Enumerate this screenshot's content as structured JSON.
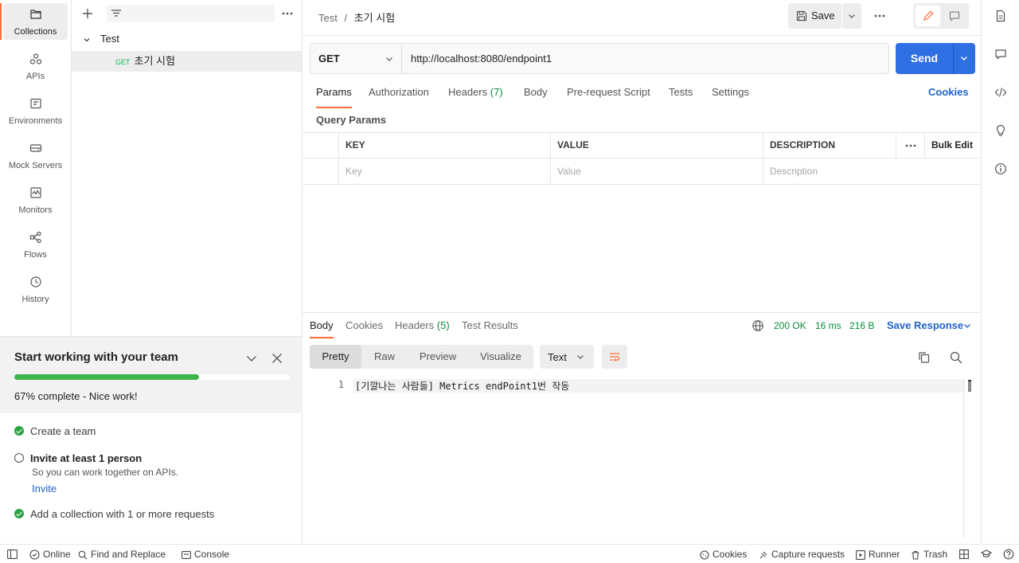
{
  "rail": {
    "items": [
      {
        "label": "Collections",
        "icon": "collections-icon"
      },
      {
        "label": "APIs",
        "icon": "apis-icon"
      },
      {
        "label": "Environments",
        "icon": "environments-icon"
      },
      {
        "label": "Mock Servers",
        "icon": "mock-servers-icon"
      },
      {
        "label": "Monitors",
        "icon": "monitors-icon"
      },
      {
        "label": "Flows",
        "icon": "flows-icon"
      },
      {
        "label": "History",
        "icon": "history-icon"
      }
    ]
  },
  "sidebar": {
    "collection_name": "Test",
    "request": {
      "method": "GET",
      "name": "초기 시험"
    }
  },
  "onboarding": {
    "title": "Start working with your team",
    "progress_percent": 67,
    "progress_text": "67% complete - Nice work!",
    "tasks": [
      {
        "label": "Create a team",
        "done": true
      },
      {
        "label": "Invite at least 1 person",
        "done": false,
        "description": "So you can work together on APIs.",
        "action": "Invite"
      },
      {
        "label": "Add a collection with 1 or more requests",
        "done": true
      }
    ]
  },
  "header": {
    "breadcrumb_parent": "Test",
    "breadcrumb_sep": "/",
    "breadcrumb_current": "초기 시험",
    "save_label": "Save"
  },
  "request": {
    "method": "GET",
    "url": "http://localhost:8080/endpoint1",
    "send_label": "Send",
    "tabs": [
      {
        "label": "Params",
        "active": true
      },
      {
        "label": "Authorization"
      },
      {
        "label": "Headers",
        "count": "(7)"
      },
      {
        "label": "Body"
      },
      {
        "label": "Pre-request Script"
      },
      {
        "label": "Tests"
      },
      {
        "label": "Settings"
      }
    ],
    "cookies_label": "Cookies",
    "query_params_title": "Query Params",
    "table": {
      "headers": {
        "key": "KEY",
        "value": "VALUE",
        "description": "DESCRIPTION",
        "bulk_edit": "Bulk Edit"
      },
      "placeholders": {
        "key": "Key",
        "value": "Value",
        "description": "Description"
      }
    }
  },
  "response": {
    "tabs": [
      {
        "label": "Body",
        "active": true
      },
      {
        "label": "Cookies"
      },
      {
        "label": "Headers",
        "count": "(5)"
      },
      {
        "label": "Test Results"
      }
    ],
    "status": "200 OK",
    "time": "16 ms",
    "size": "216 B",
    "save_response_label": "Save Response",
    "views": [
      "Pretty",
      "Raw",
      "Preview",
      "Visualize"
    ],
    "format": "Text",
    "line_number": "1",
    "body_text": "[기깔나는 사람들] Metrics endPoint1번 작동"
  },
  "statusbar": {
    "online": "Online",
    "find_replace": "Find and Replace",
    "console": "Console",
    "cookies": "Cookies",
    "capture": "Capture requests",
    "runner": "Runner",
    "trash": "Trash"
  },
  "colors": {
    "accent": "#ff6c37",
    "send_blue": "#2f6fe4",
    "success_green": "#0a8a3a",
    "link_blue": "#1f62c9"
  }
}
